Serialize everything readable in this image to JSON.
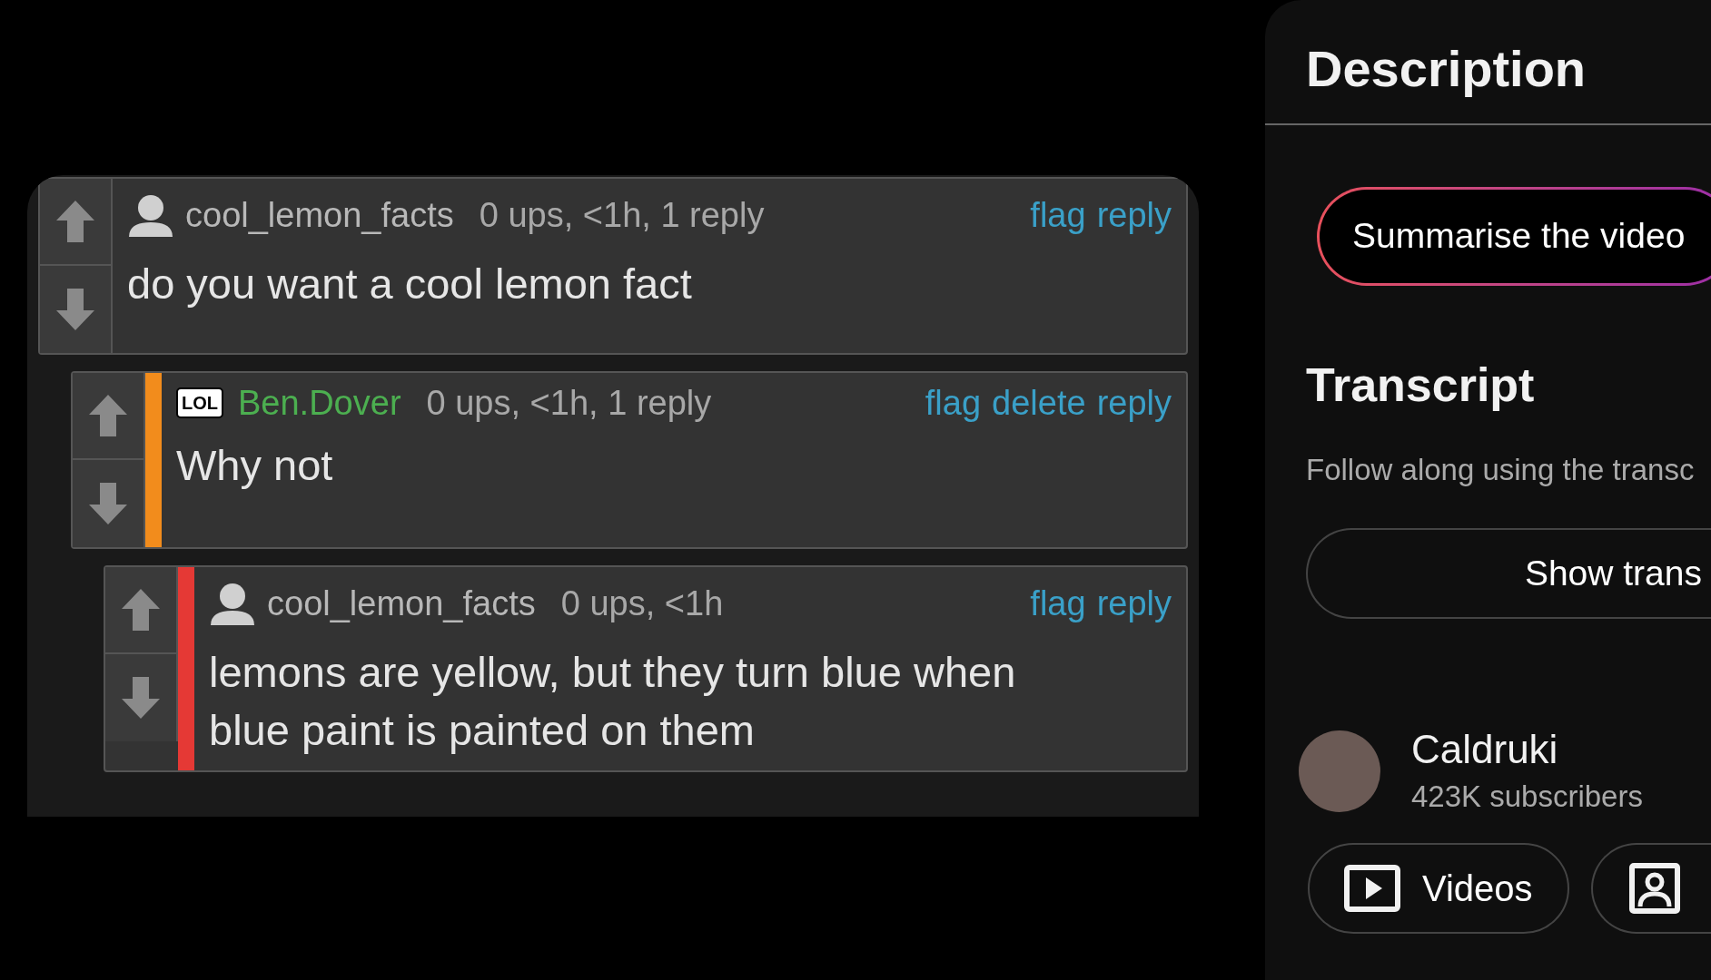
{
  "comments": [
    {
      "kind": "person",
      "user": {
        "name": "cool_lemon_facts",
        "color": "#b8b8b8"
      },
      "meta": "0 ups, <1h, 1 reply",
      "actions": [
        "flag",
        "reply"
      ],
      "text": "do you want a cool lemon fact",
      "children": [
        {
          "kind": "lol",
          "avatar_label": "LOL",
          "color": "#f28c1c",
          "user": {
            "name": "Ben.Dover",
            "color": "#4caf50"
          },
          "meta": "0 ups, <1h, 1 reply",
          "actions": [
            "flag",
            "delete",
            "reply"
          ],
          "text": "Why not",
          "children": [
            {
              "kind": "person",
              "color": "#e53935",
              "user": {
                "name": "cool_lemon_facts",
                "color": "#b8b8b8"
              },
              "meta": "0 ups, <1h",
              "actions": [
                "flag",
                "reply"
              ],
              "text": "lemons are yellow, but they turn blue when blue paint is painted on them"
            }
          ]
        }
      ]
    }
  ],
  "panel": {
    "description_heading": "Description",
    "summarise_button": "Summarise the video",
    "transcript_heading": "Transcript",
    "transcript_text": "Follow along using the transc",
    "transcript_button": "Show trans",
    "channel": {
      "name": "Caldruki",
      "subscribers": "423K subscribers"
    },
    "buttons": [
      {
        "kind": "videos",
        "label": "Videos"
      },
      {
        "kind": "about"
      }
    ]
  }
}
